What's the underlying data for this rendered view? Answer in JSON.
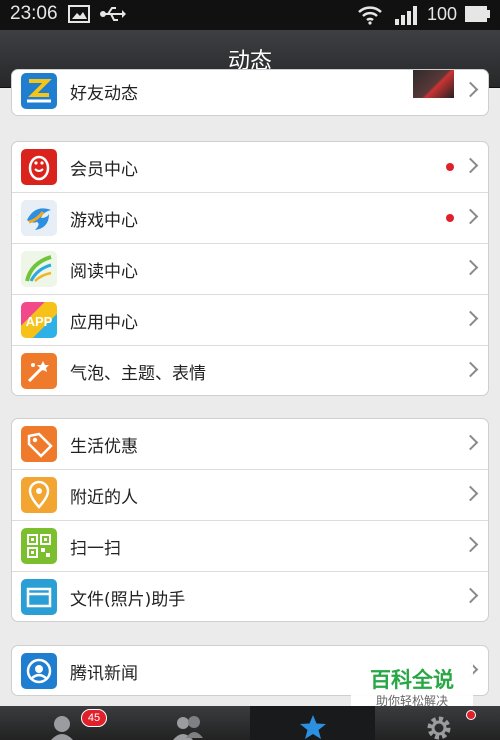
{
  "status_bar": {
    "time": "23:06",
    "battery": "100"
  },
  "header": {
    "title": "动态"
  },
  "groups": [
    {
      "items": [
        {
          "label": "好友动态",
          "icon": "friends-feed-icon"
        }
      ]
    },
    {
      "items": [
        {
          "label": "会员中心",
          "icon": "vip-penguin-icon",
          "has_dot": true
        },
        {
          "label": "游戏中心",
          "icon": "game-center-icon",
          "has_dot": true
        },
        {
          "label": "阅读中心",
          "icon": "reading-center-icon"
        },
        {
          "label": "应用中心",
          "icon": "app-center-icon",
          "icon_text": "APP"
        },
        {
          "label": "气泡、主题、表情",
          "icon": "bubble-theme-icon"
        }
      ]
    },
    {
      "items": [
        {
          "label": "生活优惠",
          "icon": "coupon-tag-icon"
        },
        {
          "label": "附近的人",
          "icon": "location-pin-icon"
        },
        {
          "label": "扫一扫",
          "icon": "qr-scan-icon"
        },
        {
          "label": "文件(照片)助手",
          "icon": "file-folder-icon"
        }
      ]
    },
    {
      "items": [
        {
          "label": "腾讯新闻",
          "icon": "tencent-news-icon"
        }
      ]
    }
  ],
  "tab_bar": {
    "messages_badge": "45"
  },
  "watermark": {
    "title": "百科全说",
    "subtitle": "助你轻松解决"
  },
  "colors": {
    "accent_red": "#e0202a",
    "vip": "#d9231c",
    "game": "#2d8fe0",
    "reading": "#6fc43a",
    "coupon": "#f07a2c",
    "location": "#f2a530",
    "qr": "#7bbf2e",
    "folder": "#2a9fd6",
    "news": "#1f7ecf"
  }
}
